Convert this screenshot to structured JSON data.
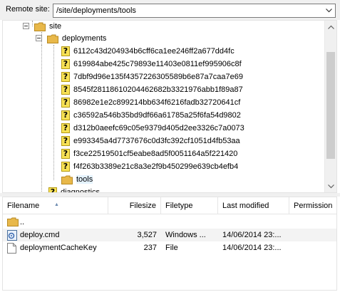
{
  "site_bar": {
    "label": "Remote site:",
    "path": "/site/deployments/tools"
  },
  "tree": {
    "site_label": "site",
    "deployments_label": "deployments",
    "unknown_items": [
      "6112c43d204934b6cff6ca1ee246ff2a677dd4fc",
      "619984abe425c79893e11403e0811ef995906c8f",
      "7dbf9d96e135f4357226305589b6e87a7caa7e69",
      "8545f28118610204462682b3321976abb1f89a87",
      "86982e1e2c899214bb634f6216fadb32720641cf",
      "c36592a546b35bd9df66a61785a25f6fa54d9802",
      "d312b0aeefc69c05e9379d405d2ee3326c7a0073",
      "e993345a4d7737676c0d3fc392cf1051d4fb53aa",
      "f3ce22519501cf5eabe8ad5f0051164a5f221420",
      "f4f263b3389e21c8a3e2f9b450299e639cb4efb4"
    ],
    "tools_label": "tools",
    "partial_label": "diagnostics",
    "unknown_glyph": "?"
  },
  "file_list": {
    "columns": {
      "filename": "Filename",
      "filesize": "Filesize",
      "filetype": "Filetype",
      "last_modified": "Last modified",
      "permissions": "Permission"
    },
    "parent_label": "..",
    "rows": [
      {
        "name": "deploy.cmd",
        "size": "3,527",
        "type": "Windows ...",
        "modified": "14/06/2014 23:..."
      },
      {
        "name": "deploymentCacheKey",
        "size": "237",
        "type": "File",
        "modified": "14/06/2014 23:..."
      }
    ]
  },
  "colors": {
    "folder_yellow": "#e8b84a",
    "unknown_yellow": "#f8e255",
    "selection": "#e5f3ff"
  }
}
